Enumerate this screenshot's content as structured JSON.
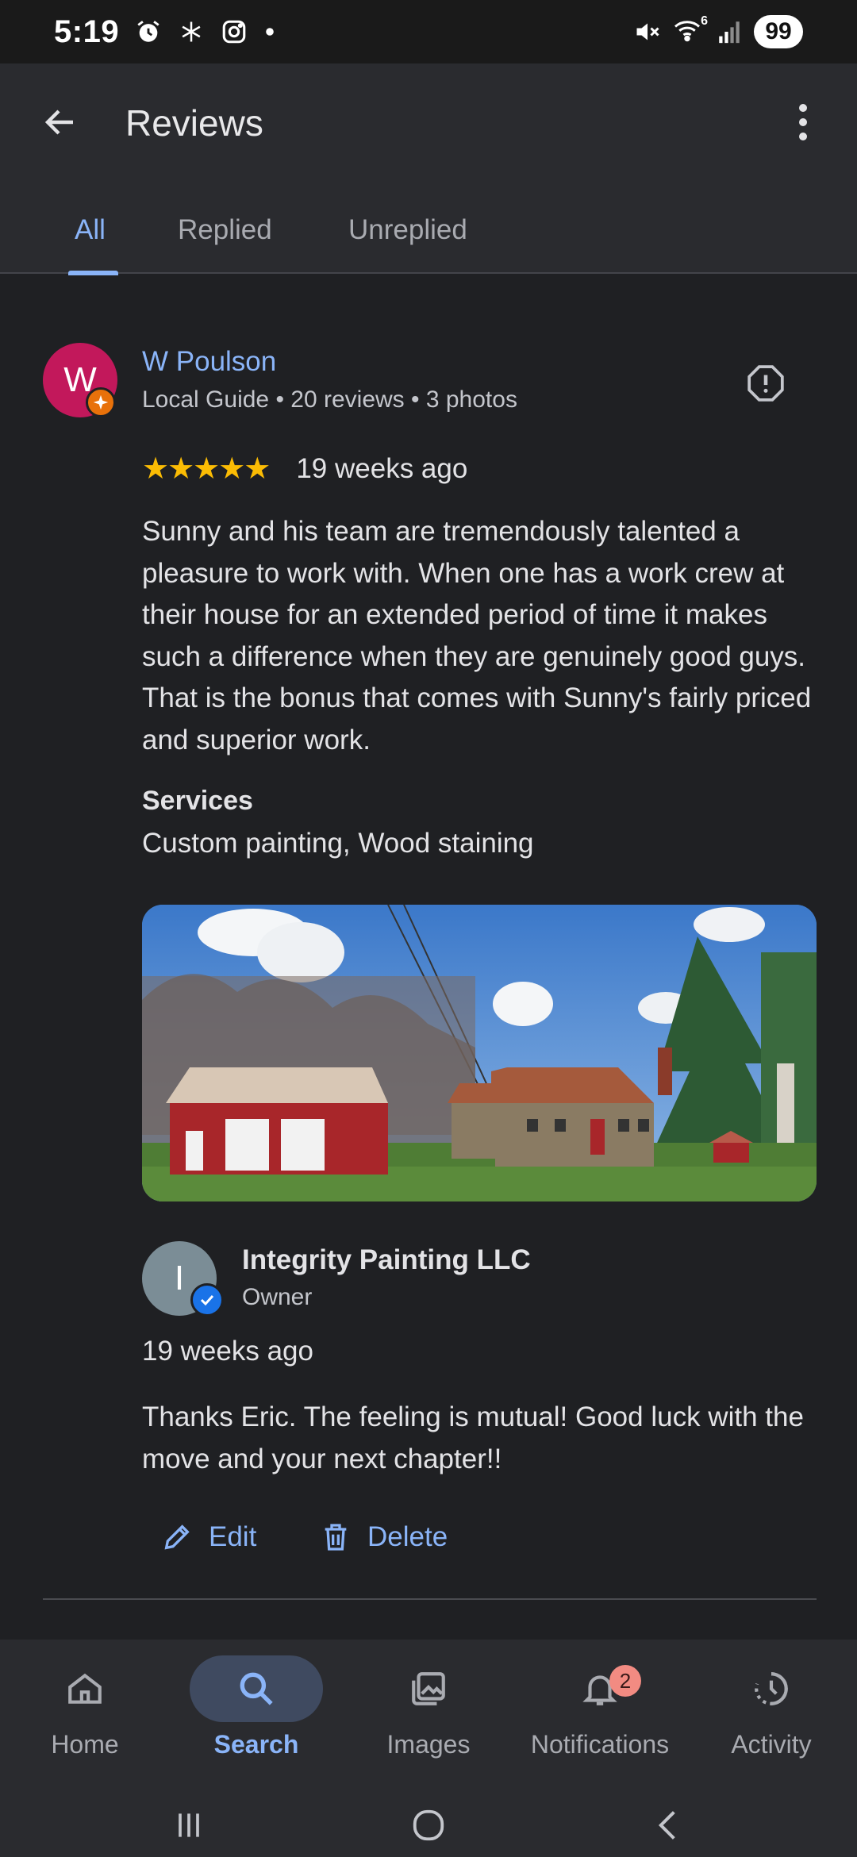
{
  "status_bar": {
    "time": "5:19",
    "left_icons": [
      "alarm-icon",
      "snowflake-icon",
      "instagram-icon",
      "dot-icon"
    ],
    "right_icons": [
      "mute-icon",
      "wifi-icon",
      "signal-icon"
    ],
    "wifi_label": "6",
    "battery": "99"
  },
  "app_bar": {
    "title": "Reviews",
    "tabs": [
      {
        "label": "All",
        "active": true
      },
      {
        "label": "Replied",
        "active": false
      },
      {
        "label": "Unreplied",
        "active": false
      }
    ]
  },
  "review": {
    "avatar_letter": "W",
    "avatar_color": "#c2185b",
    "badge_color": "#e8710a",
    "name": "W Poulson",
    "meta": "Local Guide • 20 reviews • 3 photos",
    "rating": 5,
    "stars": "★★★★★",
    "date": "19 weeks ago",
    "text": "Sunny and his team are tremendously talented a pleasure to work with. When one has a work crew at their house for an extended period of time it makes such a difference when they are genuinely good guys. That is the bonus that comes with Sunny's fairly priced and superior work.",
    "services_label": "Services",
    "services_value": "Custom painting, Wood staining"
  },
  "reply": {
    "avatar_letter": "I",
    "avatar_color": "#7b8d96",
    "name": "Integrity Painting LLC",
    "role": "Owner",
    "date": "19 weeks ago",
    "text": "Thanks Eric. The feeling is mutual! Good luck with the move and your next chapter!!",
    "edit_label": "Edit",
    "delete_label": "Delete"
  },
  "bottom_nav": {
    "items": [
      {
        "label": "Home",
        "icon": "home-icon",
        "active": false
      },
      {
        "label": "Search",
        "icon": "search-icon",
        "active": true
      },
      {
        "label": "Images",
        "icon": "images-icon",
        "active": false
      },
      {
        "label": "Notifications",
        "icon": "bell-icon",
        "active": false,
        "badge": "2"
      },
      {
        "label": "Activity",
        "icon": "activity-icon",
        "active": false
      }
    ]
  },
  "colors": {
    "accent": "#8ab4f8",
    "background": "#1f2023",
    "star": "#fbbc04"
  }
}
